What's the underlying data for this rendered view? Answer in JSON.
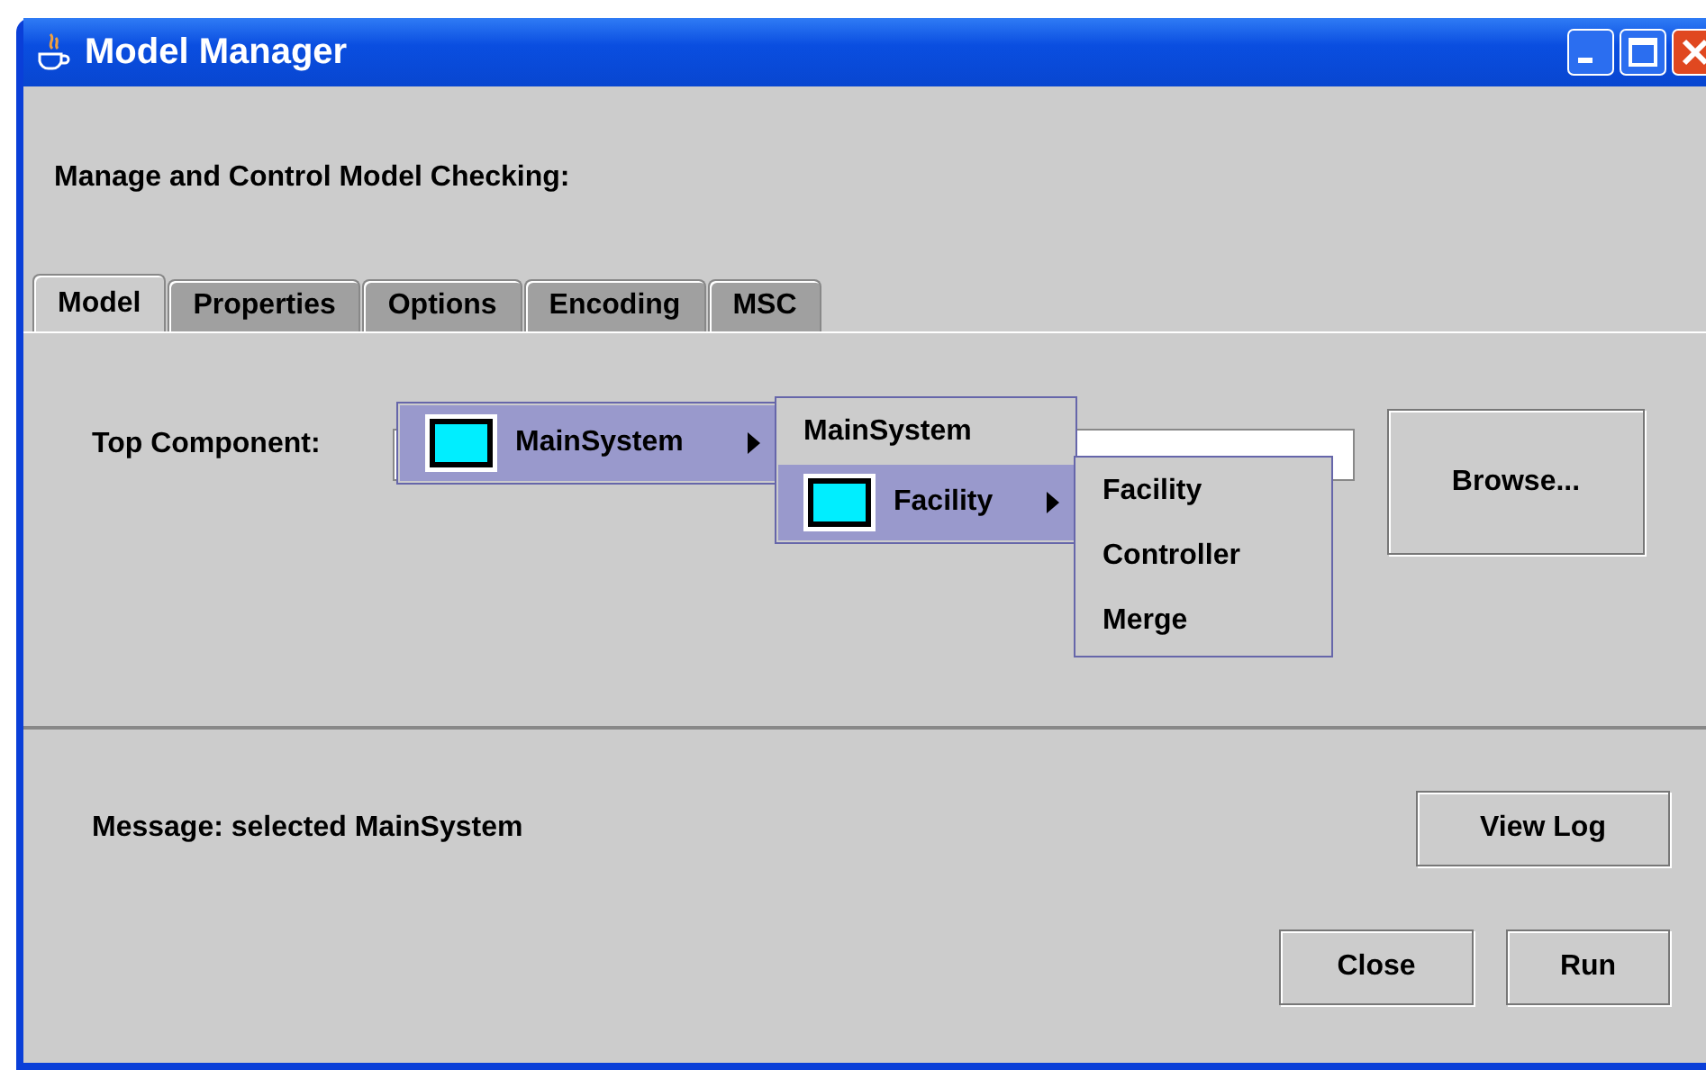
{
  "window": {
    "title": "Model Manager"
  },
  "heading": "Manage and Control Model Checking:",
  "tabs": [
    {
      "label": "Model",
      "selected": true
    },
    {
      "label": "Properties",
      "selected": false
    },
    {
      "label": "Options",
      "selected": false
    },
    {
      "label": "Encoding",
      "selected": false
    },
    {
      "label": "MSC",
      "selected": false
    }
  ],
  "top_component": {
    "label": "Top Component:",
    "browse_button": "Browse...",
    "menu": [
      {
        "label": "MainSystem",
        "selected": true,
        "children": [
          {
            "label": "MainSystem",
            "selected": false
          },
          {
            "label": "Facility",
            "selected": true,
            "children": [
              {
                "label": "Facility",
                "selected": false
              },
              {
                "label": "Controller",
                "selected": false
              },
              {
                "label": "Merge",
                "selected": false
              }
            ]
          }
        ]
      }
    ]
  },
  "message": "Message: selected MainSystem",
  "buttons": {
    "view_log": "View Log",
    "close": "Close",
    "run": "Run"
  }
}
